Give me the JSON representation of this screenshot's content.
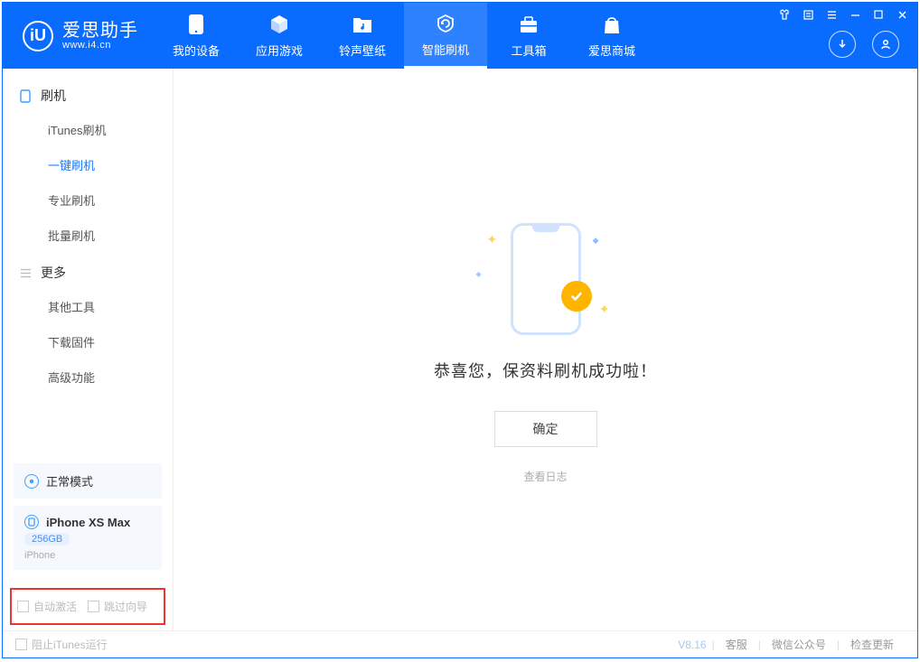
{
  "app": {
    "name": "爱思助手",
    "url": "www.i4.cn"
  },
  "nav": {
    "items": [
      {
        "label": "我的设备"
      },
      {
        "label": "应用游戏"
      },
      {
        "label": "铃声壁纸"
      },
      {
        "label": "智能刷机"
      },
      {
        "label": "工具箱"
      },
      {
        "label": "爱思商城"
      }
    ]
  },
  "sidebar": {
    "group1_title": "刷机",
    "group1_items": [
      {
        "label": "iTunes刷机"
      },
      {
        "label": "一键刷机"
      },
      {
        "label": "专业刷机"
      },
      {
        "label": "批量刷机"
      }
    ],
    "group2_title": "更多",
    "group2_items": [
      {
        "label": "其他工具"
      },
      {
        "label": "下载固件"
      },
      {
        "label": "高级功能"
      }
    ],
    "mode_label": "正常模式",
    "device": {
      "name": "iPhone XS Max",
      "storage": "256GB",
      "type": "iPhone"
    },
    "checks": {
      "auto_activate": "自动激活",
      "skip_guide": "跳过向导"
    }
  },
  "main": {
    "success_msg": "恭喜您，保资料刷机成功啦！",
    "ok_label": "确定",
    "log_link": "查看日志"
  },
  "statusbar": {
    "block_itunes": "阻止iTunes运行",
    "version": "V8.16",
    "links": {
      "service": "客服",
      "wechat": "微信公众号",
      "update": "检查更新"
    }
  }
}
